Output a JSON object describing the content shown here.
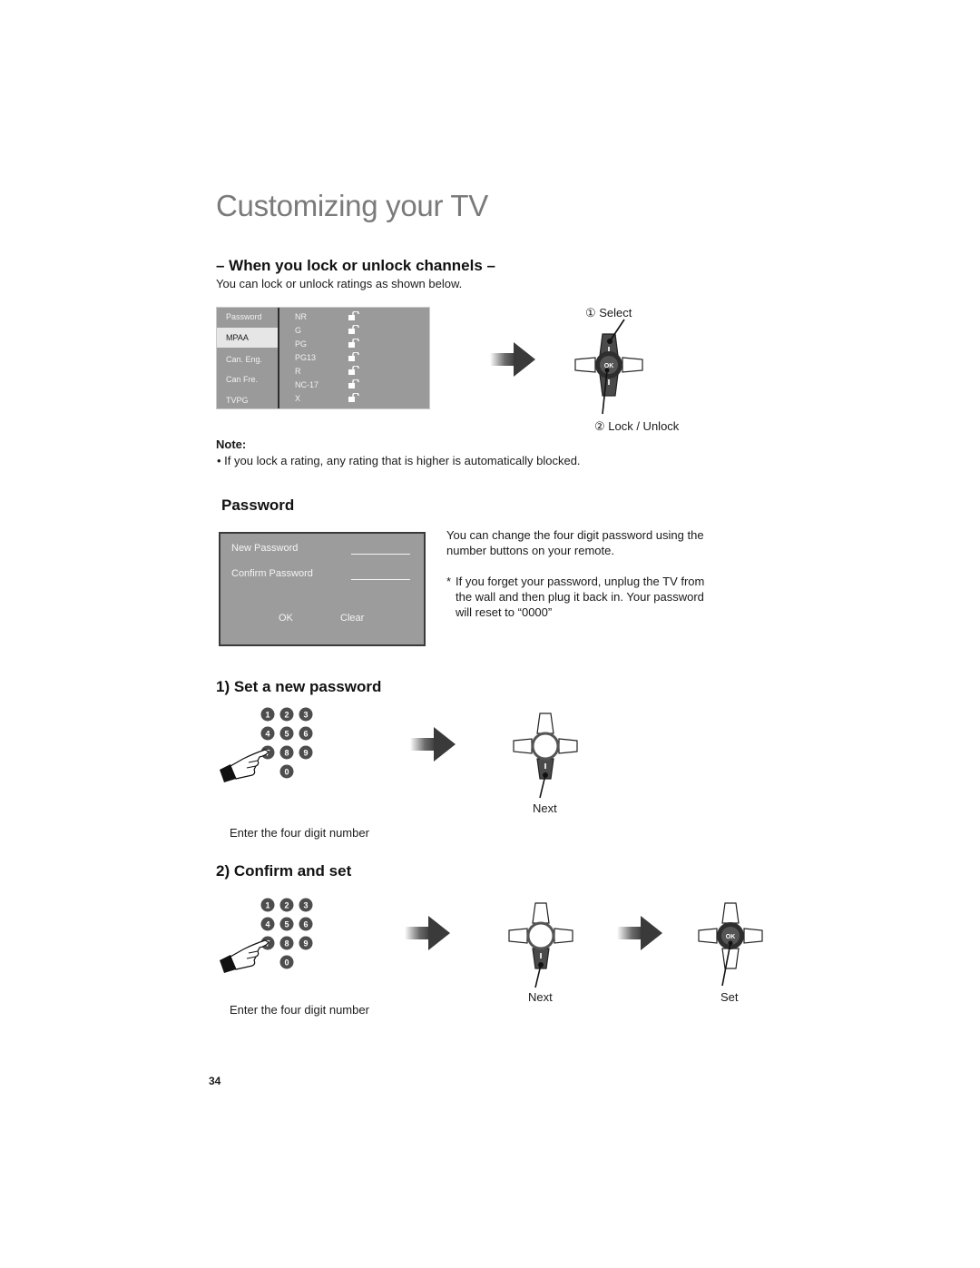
{
  "page_title": "Customizing your TV",
  "lock_section": {
    "heading": "– When you lock or unlock channels –",
    "intro": "You can lock or unlock ratings as shown below.",
    "menu": {
      "categories": [
        {
          "label": "Password",
          "active": false
        },
        {
          "label": "MPAA",
          "active": true
        },
        {
          "label": "Can. Eng.",
          "active": false
        },
        {
          "label": "Can Fre.",
          "active": false
        },
        {
          "label": "TVPG",
          "active": false
        }
      ],
      "ratings": [
        {
          "label": "NR",
          "icon": "unlocked-padlock-icon"
        },
        {
          "label": "G",
          "icon": "unlocked-padlock-icon"
        },
        {
          "label": "PG",
          "icon": "unlocked-padlock-icon"
        },
        {
          "label": "PG13",
          "icon": "unlocked-padlock-icon"
        },
        {
          "label": "R",
          "icon": "unlocked-padlock-icon"
        },
        {
          "label": "NC-17",
          "icon": "unlocked-padlock-icon"
        },
        {
          "label": "X",
          "icon": "unlocked-padlock-icon"
        }
      ]
    },
    "remote_callouts": {
      "select": "① Select",
      "lock_unlock": "② Lock / Unlock",
      "ok_label": "OK"
    },
    "note_title": "Note:",
    "note_text": "•  If you lock a rating, any rating that is higher is automatically blocked."
  },
  "password_section": {
    "heading": "Password",
    "panel": {
      "new_password_label": "New Password",
      "confirm_password_label": "Confirm Password",
      "ok_label": "OK",
      "clear_label": "Clear"
    },
    "description": "You can change the four digit password using the number buttons on your remote.",
    "footnote_marker": "*",
    "footnote": "If you forget your password, unplug the TV from the wall and then plug it back in.  Your password will reset to “0000”"
  },
  "step1": {
    "heading": "1)  Set a new password",
    "keypad_keys": [
      "1",
      "2",
      "3",
      "4",
      "5",
      "6",
      "7",
      "8",
      "9",
      "0"
    ],
    "keypad_caption": "Enter the four digit number",
    "remote_caption": "Next"
  },
  "step2": {
    "heading": "2)  Confirm and set",
    "keypad_keys": [
      "1",
      "2",
      "3",
      "4",
      "5",
      "6",
      "7",
      "8",
      "9",
      "0"
    ],
    "keypad_caption": "Enter the four digit number",
    "remote1_caption": "Next",
    "remote2_caption": "Set",
    "ok_label": "OK"
  },
  "page_number": "34",
  "colors": {
    "title_gray": "#7a7a7a",
    "menu_bg": "#9a9a9a",
    "menu_active_bg": "#e6e6e6",
    "remote_dark": "#4a4a4a"
  }
}
